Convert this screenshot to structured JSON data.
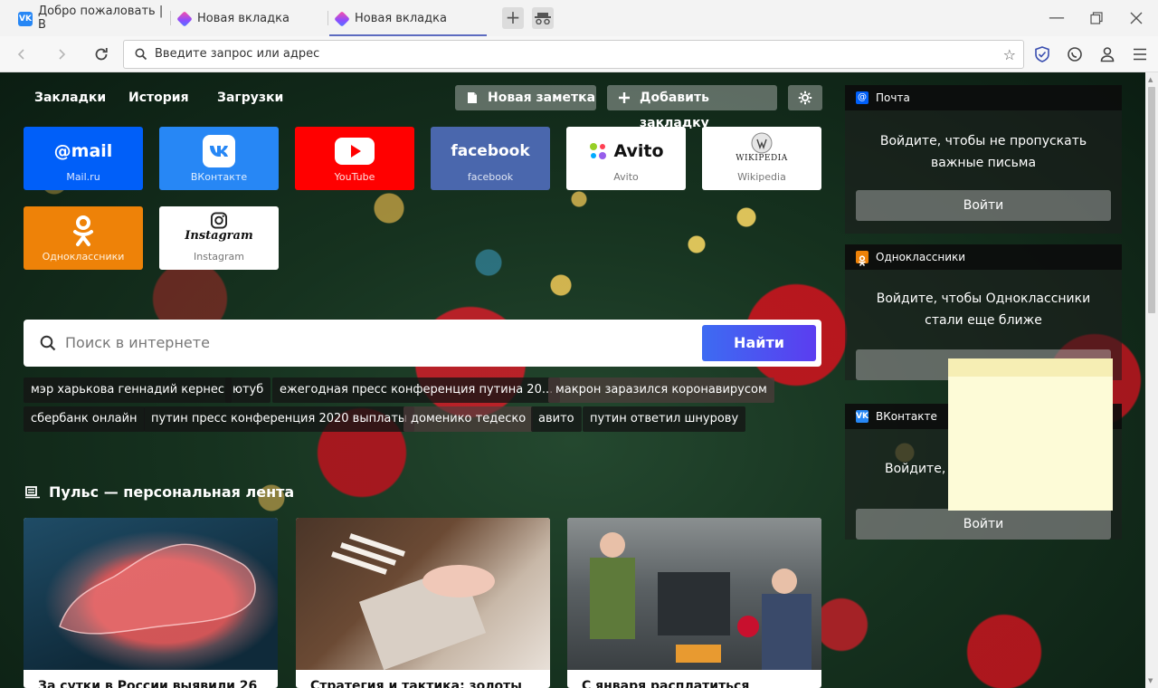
{
  "tabs": [
    {
      "title": "Добро пожаловать | В"
    },
    {
      "title": "Новая вкладка"
    },
    {
      "title": "Новая вкладка"
    }
  ],
  "address_bar": {
    "placeholder": "Введите запрос или адрес"
  },
  "top_nav": {
    "bookmarks": "Закладки",
    "history": "История",
    "downloads": "Загрузки",
    "new_note": "Новая заметка",
    "add_bookmark": "Добавить закладку"
  },
  "tiles": [
    {
      "caption": "Mail.ru",
      "logo_text": "@mail"
    },
    {
      "caption": "ВКонтакте"
    },
    {
      "caption": "YouTube"
    },
    {
      "caption": "facebook",
      "logo_text": "facebook"
    },
    {
      "caption": "Avito",
      "logo_text": "Avito"
    },
    {
      "caption": "Wikipedia",
      "logo_text": "WIKIPEDIA"
    },
    {
      "caption": "Одноклассники"
    },
    {
      "caption": "Instagram",
      "logo_text": "Instagram"
    }
  ],
  "search": {
    "placeholder": "Поиск в интернете",
    "button": "Найти"
  },
  "suggestions": [
    "мэр харькова геннадий кернес",
    "ютуб",
    "ежегодная пресс конференция путина 20...",
    "макрон заразился коронавирусом",
    "сбербанк онлайн",
    "путин пресс конференция 2020 выплаты",
    "доменико тедеско",
    "авито",
    "путин ответил шнурову"
  ],
  "pulse": {
    "title": "Пульс — персональная лента",
    "cards": [
      {
        "title": "За сутки в России выявили 26"
      },
      {
        "title": "Стратегия и тактика: золоты"
      },
      {
        "title": "С января расплатиться"
      }
    ]
  },
  "widgets": [
    {
      "name": "Почта",
      "message": [
        "Войдите, чтобы не пропускать",
        "важные письма"
      ],
      "button": "Войти"
    },
    {
      "name": "Одноклассники",
      "message": [
        "Войдите, чтобы Одноклассники",
        "стали еще ближе"
      ],
      "button": ""
    },
    {
      "name": "ВКонтакте",
      "message": [
        "Войдите, ч"
      ],
      "button": "Войти"
    }
  ],
  "colors": {
    "accent": "#2c5ef0",
    "vk": "#2787f5",
    "youtube": "#ff0000",
    "facebook": "#4a67ad",
    "ok": "#ee8208",
    "mail": "#005ff9"
  }
}
